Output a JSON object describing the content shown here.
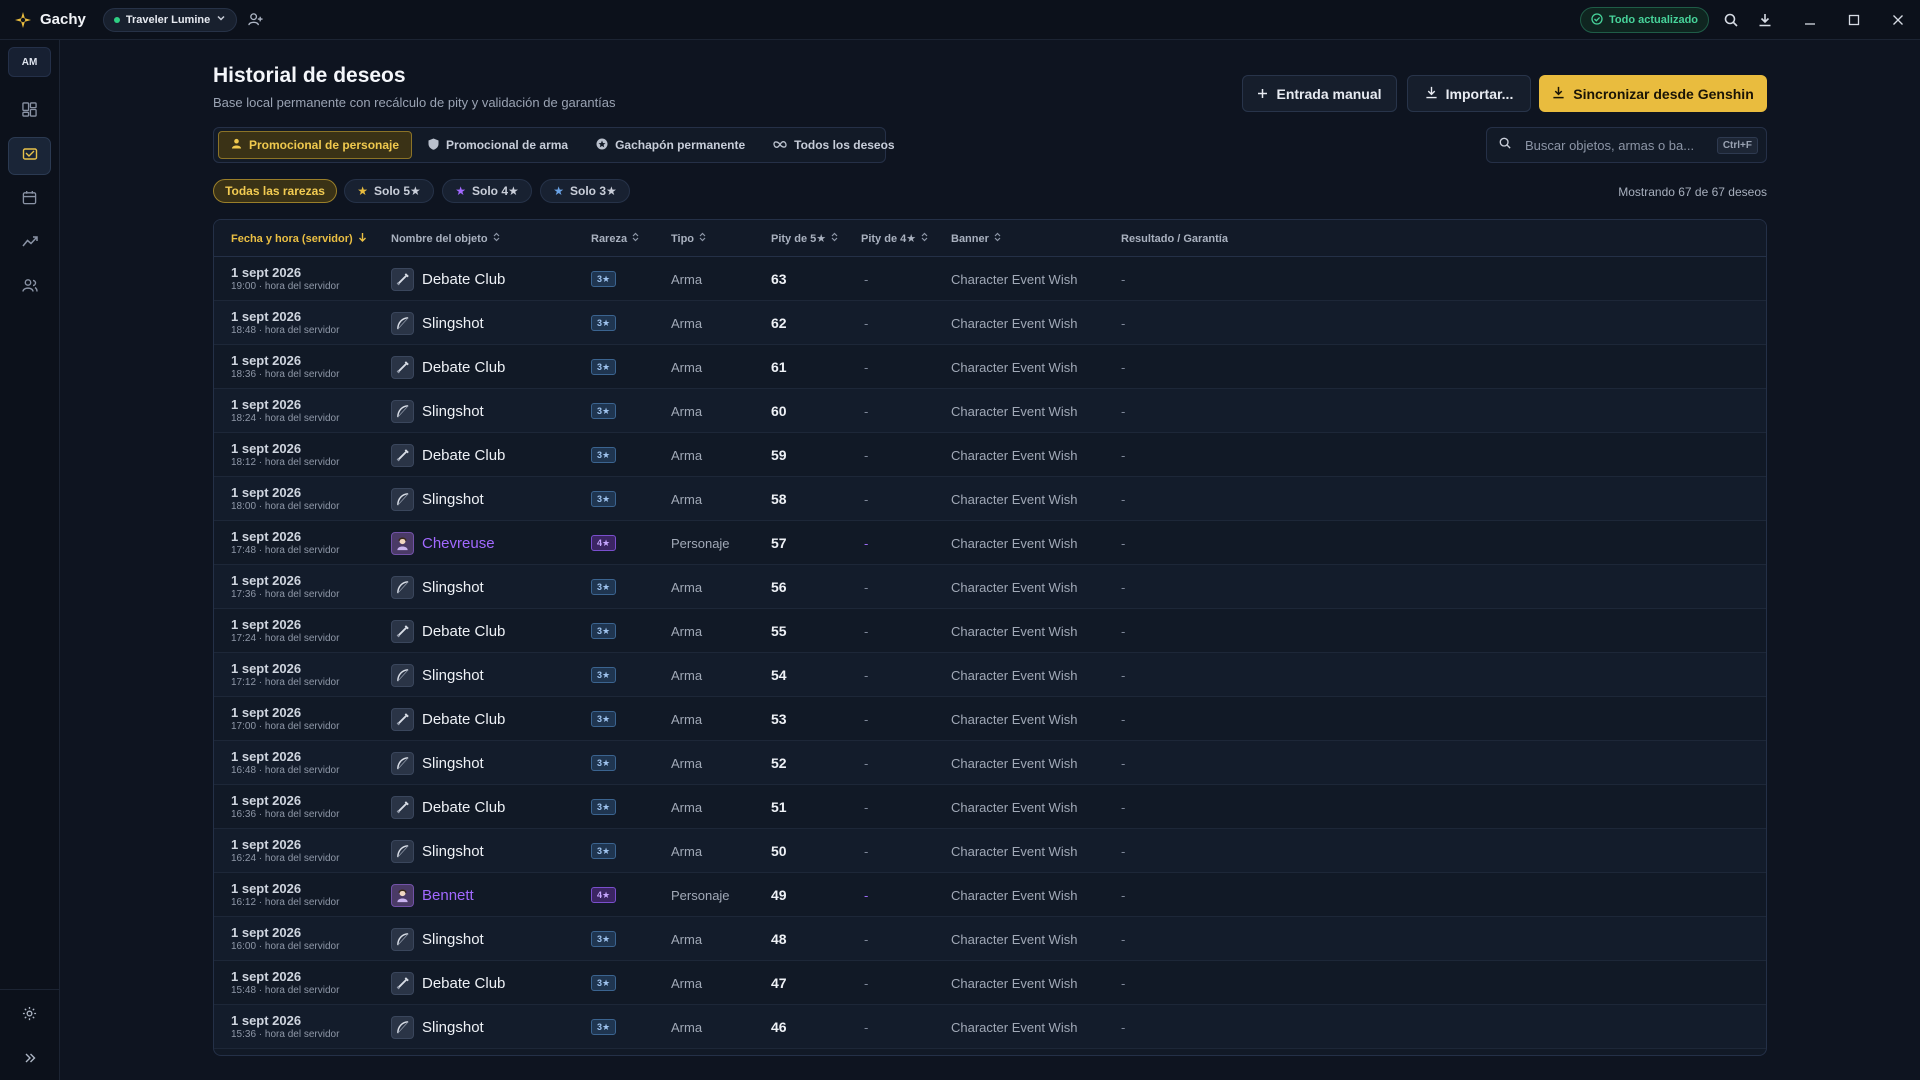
{
  "app": {
    "name": "Gachy",
    "account": "Traveler Lumine",
    "status": "Todo actualizado"
  },
  "sidebar": {
    "avatar": "AM",
    "items": [
      "dashboard-icon",
      "wish-history-icon",
      "calendar-icon",
      "analytics-icon",
      "players-icon"
    ],
    "active": 1
  },
  "page": {
    "title": "Historial de deseos",
    "subtitle": "Base local permanente con recálculo de pity y validación de garantías",
    "buttons": {
      "manual": "Entrada manual",
      "import": "Importar...",
      "sync": "Sincronizar desde Genshin"
    },
    "tabs": [
      "Promocional de personaje",
      "Promocional de arma",
      "Gachapón permanente",
      "Todos los deseos"
    ],
    "search": {
      "placeholder": "Buscar objetos, armas o ba...",
      "shortcut": "Ctrl+F"
    },
    "chips": [
      "Todas las rarezas",
      "Solo 5★",
      "Solo 4★",
      "Solo 3★"
    ],
    "count": "Mostrando 67 de 67 deseos"
  },
  "colors": {
    "accent": "#e9bc3e",
    "four_star": "#a269ff",
    "three_star": "#9fc3ee",
    "success": "#47d39a"
  },
  "table": {
    "headers": [
      "Fecha y hora (servidor)",
      "Nombre del objeto",
      "Rareza",
      "Tipo",
      "Pity de 5★",
      "Pity de 4★",
      "Banner",
      "Resultado / Garantía"
    ],
    "rows": [
      {
        "date": "1 sept 2026",
        "time": "19:00 · hora del servidor",
        "name": "Debate Club",
        "rarity": "3★",
        "type": "Arma",
        "pity5": "63",
        "pity4": "-",
        "banner": "Character Event Wish",
        "result": "-"
      },
      {
        "date": "1 sept 2026",
        "time": "18:48 · hora del servidor",
        "name": "Slingshot",
        "rarity": "3★",
        "type": "Arma",
        "pity5": "62",
        "pity4": "-",
        "banner": "Character Event Wish",
        "result": "-"
      },
      {
        "date": "1 sept 2026",
        "time": "18:36 · hora del servidor",
        "name": "Debate Club",
        "rarity": "3★",
        "type": "Arma",
        "pity5": "61",
        "pity4": "-",
        "banner": "Character Event Wish",
        "result": "-"
      },
      {
        "date": "1 sept 2026",
        "time": "18:24 · hora del servidor",
        "name": "Slingshot",
        "rarity": "3★",
        "type": "Arma",
        "pity5": "60",
        "pity4": "-",
        "banner": "Character Event Wish",
        "result": "-"
      },
      {
        "date": "1 sept 2026",
        "time": "18:12 · hora del servidor",
        "name": "Debate Club",
        "rarity": "3★",
        "type": "Arma",
        "pity5": "59",
        "pity4": "-",
        "banner": "Character Event Wish",
        "result": "-"
      },
      {
        "date": "1 sept 2026",
        "time": "18:00 · hora del servidor",
        "name": "Slingshot",
        "rarity": "3★",
        "type": "Arma",
        "pity5": "58",
        "pity4": "-",
        "banner": "Character Event Wish",
        "result": "-"
      },
      {
        "date": "1 sept 2026",
        "time": "17:48 · hora del servidor",
        "name": "Chevreuse",
        "rarity": "4★",
        "type": "Personaje",
        "pity5": "57",
        "pity4": "-",
        "banner": "Character Event Wish",
        "result": "-"
      },
      {
        "date": "1 sept 2026",
        "time": "17:36 · hora del servidor",
        "name": "Slingshot",
        "rarity": "3★",
        "type": "Arma",
        "pity5": "56",
        "pity4": "-",
        "banner": "Character Event Wish",
        "result": "-"
      },
      {
        "date": "1 sept 2026",
        "time": "17:24 · hora del servidor",
        "name": "Debate Club",
        "rarity": "3★",
        "type": "Arma",
        "pity5": "55",
        "pity4": "-",
        "banner": "Character Event Wish",
        "result": "-"
      },
      {
        "date": "1 sept 2026",
        "time": "17:12 · hora del servidor",
        "name": "Slingshot",
        "rarity": "3★",
        "type": "Arma",
        "pity5": "54",
        "pity4": "-",
        "banner": "Character Event Wish",
        "result": "-"
      },
      {
        "date": "1 sept 2026",
        "time": "17:00 · hora del servidor",
        "name": "Debate Club",
        "rarity": "3★",
        "type": "Arma",
        "pity5": "53",
        "pity4": "-",
        "banner": "Character Event Wish",
        "result": "-"
      },
      {
        "date": "1 sept 2026",
        "time": "16:48 · hora del servidor",
        "name": "Slingshot",
        "rarity": "3★",
        "type": "Arma",
        "pity5": "52",
        "pity4": "-",
        "banner": "Character Event Wish",
        "result": "-"
      },
      {
        "date": "1 sept 2026",
        "time": "16:36 · hora del servidor",
        "name": "Debate Club",
        "rarity": "3★",
        "type": "Arma",
        "pity5": "51",
        "pity4": "-",
        "banner": "Character Event Wish",
        "result": "-"
      },
      {
        "date": "1 sept 2026",
        "time": "16:24 · hora del servidor",
        "name": "Slingshot",
        "rarity": "3★",
        "type": "Arma",
        "pity5": "50",
        "pity4": "-",
        "banner": "Character Event Wish",
        "result": "-"
      },
      {
        "date": "1 sept 2026",
        "time": "16:12 · hora del servidor",
        "name": "Bennett",
        "rarity": "4★",
        "type": "Personaje",
        "pity5": "49",
        "pity4": "-",
        "banner": "Character Event Wish",
        "result": "-"
      },
      {
        "date": "1 sept 2026",
        "time": "16:00 · hora del servidor",
        "name": "Slingshot",
        "rarity": "3★",
        "type": "Arma",
        "pity5": "48",
        "pity4": "-",
        "banner": "Character Event Wish",
        "result": "-"
      },
      {
        "date": "1 sept 2026",
        "time": "15:48 · hora del servidor",
        "name": "Debate Club",
        "rarity": "3★",
        "type": "Arma",
        "pity5": "47",
        "pity4": "-",
        "banner": "Character Event Wish",
        "result": "-"
      },
      {
        "date": "1 sept 2026",
        "time": "15:36 · hora del servidor",
        "name": "Slingshot",
        "rarity": "3★",
        "type": "Arma",
        "pity5": "46",
        "pity4": "-",
        "banner": "Character Event Wish",
        "result": "-"
      }
    ]
  }
}
